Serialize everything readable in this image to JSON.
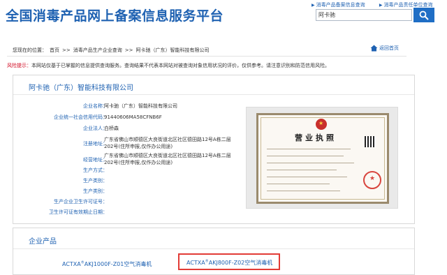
{
  "header": {
    "site_title": "全国消毒产品网上备案信息服务平台",
    "top_links": [
      "消毒产品备案信息查询",
      "消毒产品责任单位查询"
    ],
    "search": {
      "value": "阿卡驰",
      "placeholder": ""
    },
    "search_button_icon": "search-icon"
  },
  "breadcrumb": {
    "prefix": "您现在的位置：",
    "items": [
      "首页",
      ">>",
      "消毒产品生产企业查询",
      ">>",
      "阿卡驰（广东）智能科技有限公司"
    ],
    "home_link": "返回首页"
  },
  "risk": {
    "label": "风险提示：",
    "text": "本网站仅基于已掌握的信息提供查询服务。查询结果不代表本网站对被查询对象信用状况的评价，仅供参考。请注意识别和防范信用风险。"
  },
  "company": {
    "name": "阿卡驰（广东）智能科技有限公司",
    "fields": [
      {
        "label": "企业名称：",
        "value": "阿卡驰（广东）智能科技有限公司"
      },
      {
        "label": "企业统一社会信用代码：",
        "value": "91440606MA58CFNB6F"
      },
      {
        "label": "企业法人：",
        "value": "白桥森"
      },
      {
        "label": "注册地址：",
        "value": "广东省佛山市顺德区大良街道北区社区德田路12号A栋二层202号(住所申报,仅作办公用途)"
      },
      {
        "label": "经营地址：",
        "value": "广东省佛山市顺德区大良街道北区社区德田路12号A栋二层202号(住所申报,仅作办公用途)"
      },
      {
        "label": "生产方式：",
        "value": ""
      },
      {
        "label": "生产类别：",
        "value": ""
      },
      {
        "label": "生产类别：",
        "value": ""
      },
      {
        "label": "生产企业卫生许可证号：",
        "value": ""
      },
      {
        "label": "卫生许可证有效期止日期：",
        "value": ""
      }
    ],
    "license_title": "营业执照"
  },
  "products": {
    "title": "企业产品",
    "items": [
      {
        "brand": "ACTXA",
        "reg": "®",
        "model": "AKJ1000F-Z01空气消毒机"
      },
      {
        "brand": "ACTXA",
        "reg": "®",
        "model": "AKJ800F-Z02空气消毒机"
      }
    ]
  },
  "colors": {
    "brand_blue": "#1f62b2",
    "risk_red": "#d0021b",
    "highlight_red": "#e23b36"
  }
}
